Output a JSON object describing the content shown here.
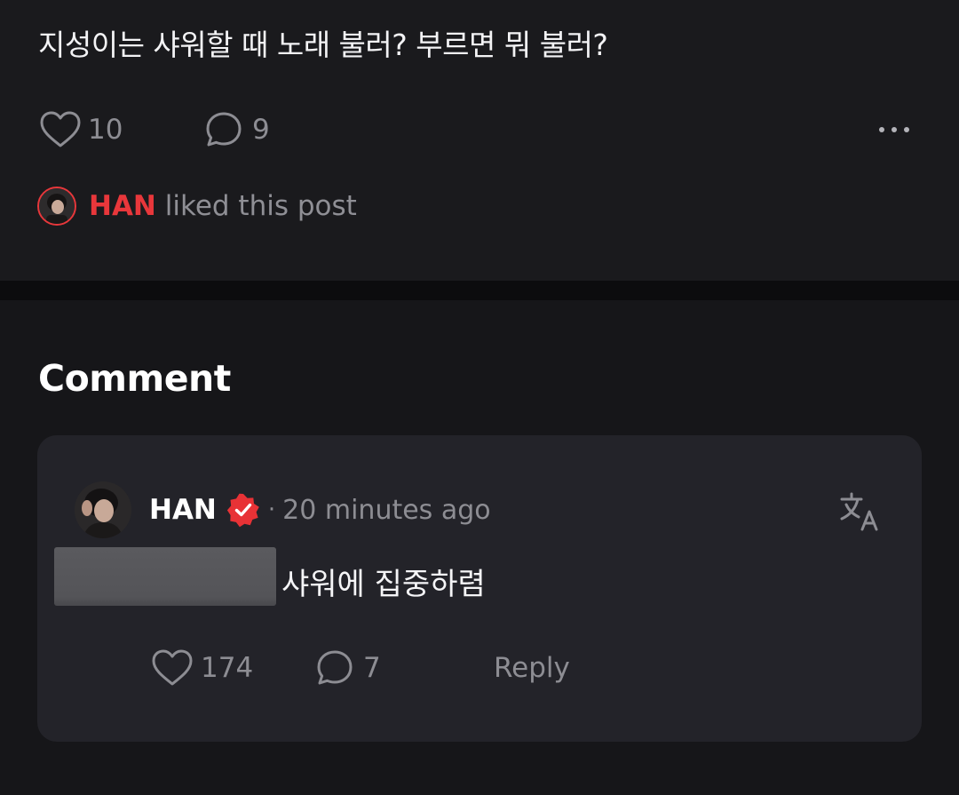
{
  "post": {
    "text": "지성이는 샤워할 때 노래 불러? 부르면 뭐 불러?",
    "like_count": "10",
    "comment_count": "9",
    "liked_by": {
      "name": "HAN",
      "suffix": "liked this post"
    }
  },
  "comments_section": {
    "title": "Comment",
    "comments": [
      {
        "author": "HAN",
        "time": "20 minutes ago",
        "separator": "·",
        "body": "샤워에 집중하렴",
        "like_count": "174",
        "reply_count": "7",
        "reply_label": "Reply"
      }
    ]
  },
  "colors": {
    "background": "#161619",
    "card": "#232329",
    "accent_red": "#e8373b",
    "muted_text": "#8d8d93"
  },
  "icons": [
    "heart-icon",
    "comment-bubble-icon",
    "more-dots-icon",
    "verified-badge-icon",
    "translate-icon"
  ]
}
